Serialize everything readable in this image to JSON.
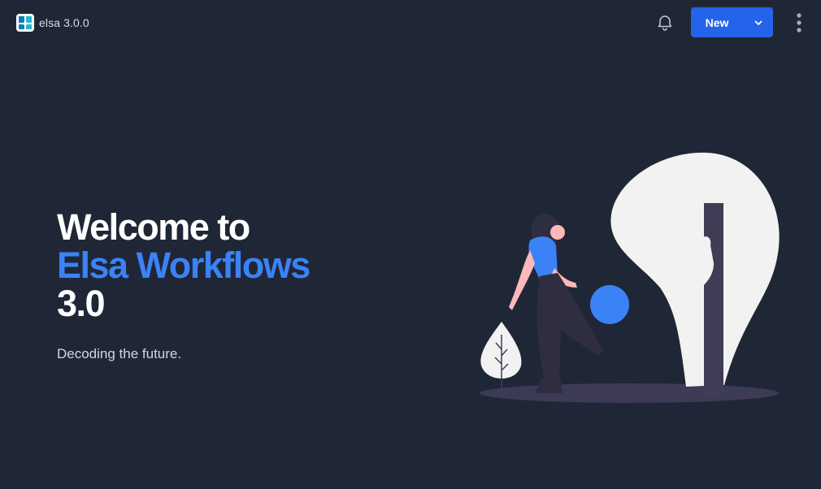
{
  "header": {
    "brand_name": "elsa 3.0.0",
    "logo_icon": "elsa-logo-icon",
    "notification_icon": "bell-icon",
    "new_button_label": "New",
    "new_button_caret_icon": "chevron-down-icon",
    "more_menu_icon": "kebab-menu-icon"
  },
  "hero": {
    "line1": "Welcome to",
    "line2": "Elsa Workflows",
    "line3": "3.0",
    "tagline": "Decoding the future."
  },
  "colors": {
    "background": "#1f2737",
    "accent": "#3b82f6",
    "button": "#2563eb"
  }
}
